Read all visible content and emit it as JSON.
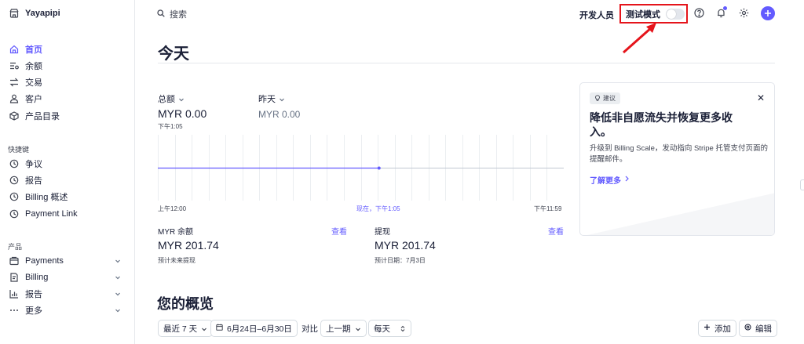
{
  "brand": {
    "name": "Yayapipi",
    "icon": "store-icon"
  },
  "sidebar": {
    "main": [
      {
        "label": "首页",
        "icon": "home-icon",
        "active": true
      },
      {
        "label": "余额",
        "icon": "balance-icon"
      },
      {
        "label": "交易",
        "icon": "transfer-icon"
      },
      {
        "label": "客户",
        "icon": "person-icon"
      },
      {
        "label": "产品目录",
        "icon": "box-icon"
      }
    ],
    "shortcuts_label": "快捷键",
    "shortcuts": [
      {
        "label": "争议",
        "icon": "clock-icon"
      },
      {
        "label": "报告",
        "icon": "clock-icon"
      },
      {
        "label": "Billing 概述",
        "icon": "clock-icon"
      },
      {
        "label": "Payment Link",
        "icon": "clock-icon"
      }
    ],
    "products_label": "产品",
    "products": [
      {
        "label": "Payments",
        "icon": "wallet-icon"
      },
      {
        "label": "Billing",
        "icon": "invoice-icon"
      },
      {
        "label": "报告",
        "icon": "bar-chart-icon"
      },
      {
        "label": "更多",
        "icon": "more-dots-icon"
      }
    ]
  },
  "topbar": {
    "search_placeholder": "搜索",
    "developers": "开发人员",
    "test_mode": "测试模式",
    "test_mode_on": false
  },
  "page": {
    "title": "今天"
  },
  "metrics": {
    "total_label": "总额",
    "total_value": "MYR 0.00",
    "total_time": "下午1:05",
    "yesterday_label": "昨天",
    "yesterday_value": "MYR 0.00"
  },
  "chart_data": {
    "type": "line",
    "x_labels": [
      "上午12:00",
      "现在，下午1:05",
      "下午11:59"
    ],
    "x_range_hours": [
      0,
      24
    ],
    "series": [
      {
        "x": [
          0,
          13.08
        ],
        "y": [
          0,
          0
        ]
      }
    ],
    "ylim": [
      0,
      1
    ],
    "grid": true
  },
  "balance": {
    "label": "MYR 余额",
    "link": "查看",
    "value": "MYR 201.74",
    "sub": "预计未来提现"
  },
  "payout": {
    "label": "提现",
    "link": "查看",
    "value": "MYR 201.74",
    "sub": "预计日期：7月3日"
  },
  "suggestion": {
    "chip": "建议",
    "title": "降低非自愿流失并恢复更多收入。",
    "body": "升级到 Billing Scale，发动指向 Stripe 托管支付页面的提醒邮件。",
    "link": "了解更多"
  },
  "overview": {
    "title": "您的概览",
    "range": "最近 7 天",
    "dates": "6月24日–6月30日",
    "compare_label": "对比",
    "compare": "上一期",
    "interval": "每天",
    "add": "添加",
    "edit": "编辑"
  },
  "colors": {
    "accent": "#635bff",
    "highlight": "#e5141b"
  }
}
